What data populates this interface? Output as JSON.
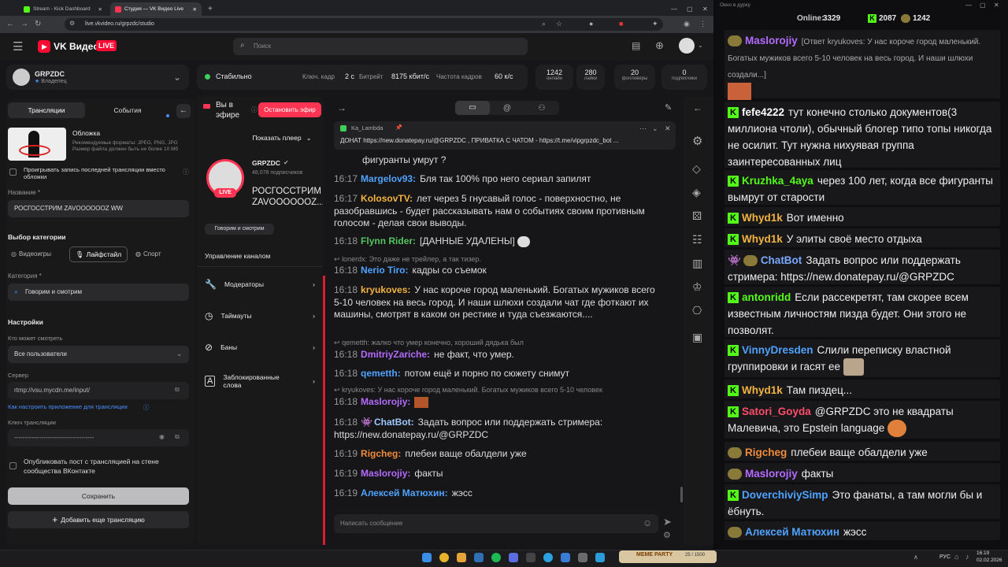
{
  "browser": {
    "tabs": [
      "Stream - Kick Dashboard",
      "Студия — VK Видео Live"
    ],
    "url": "live.vkvideo.ru/grpzdc/studio"
  },
  "header": {
    "brand": "VK Видео",
    "live_badge": "LIVE",
    "search_placeholder": "Поиск"
  },
  "channel": {
    "name": "GRPZDC",
    "role": "Владелец"
  },
  "status_bar": {
    "state": "Стабильно",
    "keyframe_label": "Ключ. кадр",
    "keyframe_value": "2 с",
    "bitrate_label": "Битрейт",
    "bitrate_value": "8175 кбит/с",
    "fps_label": "Частота кадров",
    "fps_value": "60 к/с",
    "stats": [
      {
        "value": "1242",
        "label": "онлайн"
      },
      {
        "value": "280",
        "label": "лайки"
      },
      {
        "value": "20",
        "label": "фолловеры"
      },
      {
        "value": "0",
        "label": "подписчики"
      }
    ]
  },
  "left": {
    "tab_streams": "Трансляции",
    "tab_events": "События",
    "cover_title": "Обложка",
    "cover_hint": "Рекомендуемые форматы: JPEG, PNG, JPG Размер файла должен быть не более 10 Мб",
    "replay_checkbox": "Проигрывать запись последней трансляции вместо обложки",
    "name_label": "Название *",
    "name_value": "РОСГОССТРИМ ZAVOOOOOOZ WW",
    "category_section": "Выбор категории",
    "cat_games": "Видеоигры",
    "cat_life": "Лайфстайл",
    "cat_sport": "Спорт",
    "category_label": "Категория *",
    "category_value": "Говорим и смотрим",
    "settings": "Настройки",
    "who_label": "Кто может смотреть",
    "who_value": "Все пользователи",
    "server_label": "Сервер",
    "server_value": "rtmp://vsu.mycdn.me/input/",
    "howto_link": "Как настроить приложение для трансляции",
    "key_label": "Ключ трансляции",
    "key_value": "--------------------------------------",
    "publish_checkbox": "Опубликовать пост с трансляцией на стене сообщества ВКонтакте",
    "save": "Сохранить",
    "add_stream": "Добавить еще трансляцию"
  },
  "middle": {
    "on_air": "Вы в эфире",
    "stop": "Остановить эфир",
    "show_player": "Показать плеер",
    "channel_name": "GRPZDC",
    "subs": "48,078 подписчиков",
    "stream_title": "РОСГОССТРИМ ZAVOOOOOOZ...",
    "tag": "Говорим и смотрим",
    "manage": "Управление каналом",
    "menu": [
      "Модераторы",
      "Таймауты",
      "Баны",
      "Заблокированные слова"
    ]
  },
  "chat": {
    "pinned_user": "Ka_Lambda",
    "pinned_text": "ДОНАТ https://new.donatepay.ru/@GRPZDC , ПРИВАТКА С ЧАТОМ - https://t.me/vipgrpzdc_bot ...",
    "messages": [
      {
        "time": "",
        "user": "",
        "color": "#ddd",
        "text": "фигуранты умрут ?"
      },
      {
        "time": "16:17",
        "user": "Margelov93:",
        "color": "#4fa3ff",
        "text": "Бля так 100% про него сериал запилят"
      },
      {
        "time": "16:17",
        "user": "KolosovTV:",
        "color": "#f3b340",
        "text": "лет через 5 гнусавый голос - поверхностно, не разобравшись - будет рассказывать нам о событиях своим противным голосом - делая свои выводы."
      },
      {
        "time": "16:18",
        "user": "Flynn Rider:",
        "color": "#54c45e",
        "text": "[ДАННЫЕ УДАЛЕНЫ]"
      },
      {
        "time": "16:18",
        "user": "Nerio Tiro:",
        "color": "#4fa3ff",
        "text": "кадры со съемок"
      },
      {
        "time": "16:18",
        "user": "kryukoves:",
        "color": "#f3b340",
        "text": "У нас короче город маленький. Богатых мужиков всего 5-10 человек на весь город. И наши шлюхи создали чат где фоткают их машины, смотрят в каком он рестике и туда съезжаются...."
      },
      {
        "time": "16:18",
        "user": "DmitriyZariche:",
        "color": "#b36bff",
        "text": "не факт, что умер."
      },
      {
        "time": "16:18",
        "user": "qemetth:",
        "color": "#4fa3ff",
        "text": "потом ещё и порно по сюжету снимут"
      },
      {
        "time": "16:18",
        "user": "Maslorojiy:",
        "color": "#b36bff",
        "text": ""
      },
      {
        "time": "16:18",
        "user": "ChatBot:",
        "color": "#9ec8ff",
        "text": "Задать вопрос или поддержать стримера: https://new.donatepay.ru/@GRPZDC"
      },
      {
        "time": "16:19",
        "user": "Rigcheg:",
        "color": "#f08a3c",
        "text": "плебеи ваще обалдели уже"
      },
      {
        "time": "16:19",
        "user": "Maslorojiy:",
        "color": "#b36bff",
        "text": "факты"
      },
      {
        "time": "16:19",
        "user": "Алексей Матюхин:",
        "color": "#4fa3ff",
        "text": "жэсс"
      }
    ],
    "replies": [
      "lonerdx: Это даже не трейлер, а так тизер.",
      "qemetth: жалко что умер конечно, хороший дядька был",
      "kryukoves: У нас короче город маленький. Богатых мужиков всего 5-10 человек"
    ],
    "input_placeholder": "Написать сообщение"
  },
  "kick": {
    "window_title": "Окно в дурку",
    "online_label": "Online:",
    "online": "3329",
    "kick_count": "2087",
    "vk_count": "1242",
    "messages": [
      {
        "user": "Maslorojiy",
        "color": "#b36bff",
        "badge": "avatar",
        "text": "[Ответ kryukoves: У нас короче город маленький. Богатых мужиков всего 5-10 человек на весь город. И наши шлюхи создали...]"
      },
      {
        "user": "fefe4222",
        "color": "#ffffff",
        "badge": "kick",
        "text": "тут конечно столько документов(3 миллиона чтоли), обычный блогер типо топы никогда не осилит. Тут нужна нихуявая группа заинтересованных лиц"
      },
      {
        "user": "Kruzhka_4aya",
        "color": "#53fc18",
        "badge": "kick",
        "text": "через 100 лет, когда все фигуранты вымрут от старости"
      },
      {
        "user": "Whyd1k",
        "color": "#f3b340",
        "badge": "kick",
        "text": "Вот именно"
      },
      {
        "user": "Whyd1k",
        "color": "#f3b340",
        "badge": "kick",
        "text": "У элиты своё место отдыха"
      },
      {
        "user": "ChatBot",
        "color": "#7aa8ff",
        "badge": "bot",
        "text": "Задать вопрос или поддержать стримера: https://new.donatepay.ru/@GRPZDC"
      },
      {
        "user": "antonridd",
        "color": "#53fc18",
        "badge": "kick",
        "text": "Если рассекретят, там скорее всем известным личностям пизда будет. Они этого не позволят."
      },
      {
        "user": "VinnyDresden",
        "color": "#4fa3ff",
        "badge": "kick",
        "text": "Слили переписку властной группировки и гасят ее"
      },
      {
        "user": "Whyd1k",
        "color": "#f3b340",
        "badge": "kick",
        "text": "Там пиздец..."
      },
      {
        "user": "Satori_Goyda",
        "color": "#ff4d6a",
        "badge": "kick",
        "text": "@GRPZDC это не квадраты Малевича, это Epstein language"
      },
      {
        "user": "Rigcheg",
        "color": "#f08a3c",
        "badge": "avatar",
        "text": "плебеи ваще обалдели уже"
      },
      {
        "user": "Maslorojiy",
        "color": "#b36bff",
        "badge": "avatar",
        "text": "факты"
      },
      {
        "user": "DoverchiviySimp",
        "color": "#4fa3ff",
        "badge": "kick",
        "text": "Это фанаты, а там могли бы и ёбнуть."
      },
      {
        "user": "Алексей Матюхин",
        "color": "#4fa3ff",
        "badge": "avatar",
        "text": "жэсс"
      }
    ]
  },
  "taskbar": {
    "lang": "РУС",
    "time": "16:19",
    "date": "02.02.2026",
    "meme_label": "MEME PARTY",
    "meme_count": "25 / 1500"
  }
}
